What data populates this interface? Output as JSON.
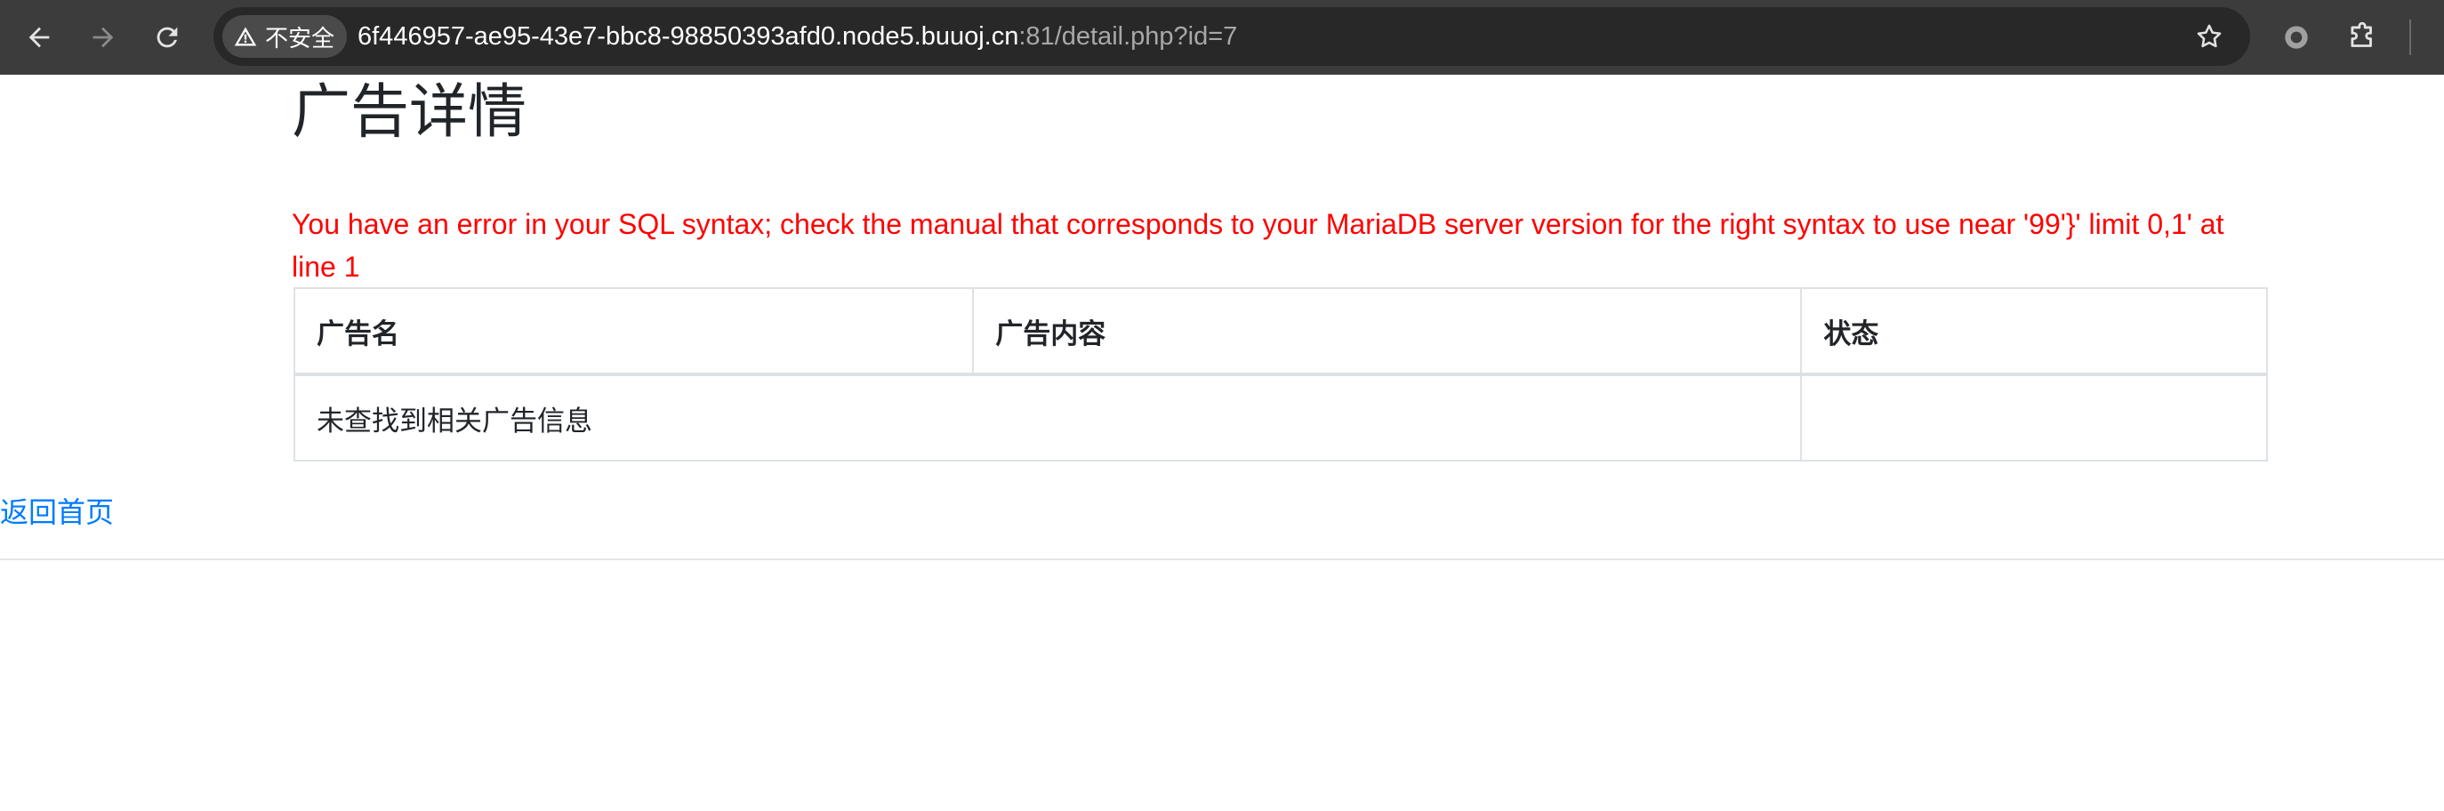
{
  "browser": {
    "security_label": "不安全",
    "url_host": "6f446957-ae95-43e7-bbc8-98850393afd0.node5.buuoj.cn",
    "url_path": ":81/detail.php?id=7",
    "icons": {
      "back": "arrow-left-icon",
      "forward": "arrow-right-icon",
      "reload": "reload-icon",
      "warning": "warning-triangle-icon",
      "bookmark": "star-icon",
      "profile": "circle-icon",
      "extensions": "puzzle-icon"
    }
  },
  "page": {
    "title": "广告详情",
    "error_message": "You have an error in your SQL syntax; check the manual that corresponds to your MariaDB server version for the right syntax to use near '99'}' limit 0,1' at line 1",
    "table": {
      "headers": [
        "广告名",
        "广告内容",
        "状态"
      ],
      "empty_message": "未查找到相关广告信息"
    },
    "back_link": "返回首页",
    "colors": {
      "error": "#ff0000",
      "link": "#007bff"
    }
  }
}
